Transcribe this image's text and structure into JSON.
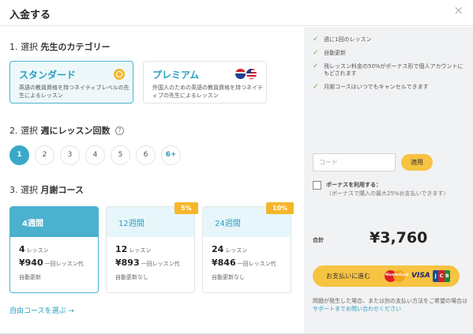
{
  "header": {
    "title": "入金する",
    "close": "×"
  },
  "step1": {
    "num": "1. 選択",
    "label": "先生のカテゴリー",
    "categories": [
      {
        "name": "スタンダード",
        "desc": "英語の教員資格を持つネイティブレベルの先生によるレッスン",
        "icon": "globe-icon"
      },
      {
        "name": "プレミアム",
        "desc": "外国人のための英語の教員資格を持つネイティブの先生によるレッスン",
        "icon": "flags-icon"
      }
    ]
  },
  "step2": {
    "num": "2. 選択",
    "label": "週にレッスン回数",
    "help": "?",
    "options": [
      "1",
      "2",
      "3",
      "4",
      "5",
      "6",
      "6+"
    ],
    "selected": "1"
  },
  "step3": {
    "num": "3. 選択",
    "label": "月謝コース",
    "courses": [
      {
        "weeks": "4週間",
        "lessons": "4",
        "lessons_unit": "レッスン",
        "price": "¥940",
        "price_unit": "一回レッスン代",
        "renew": "自動更新",
        "badge": ""
      },
      {
        "weeks": "12週間",
        "lessons": "12",
        "lessons_unit": "レッスン",
        "price": "¥893",
        "price_unit": "一回レッスン代",
        "renew": "自動更新なし",
        "badge": "5%"
      },
      {
        "weeks": "24週間",
        "lessons": "24",
        "lessons_unit": "レッスン",
        "price": "¥846",
        "price_unit": "一回レッスン代",
        "renew": "自動更新なし",
        "badge": "10%"
      }
    ],
    "free_link": "自由コースを選ぶ →"
  },
  "sidebar": {
    "features": [
      "週に1回のレッスン",
      "自動更新",
      "残レッスン料金の50%がボーナス形で個人アカウントにもどされます",
      "月謝コースはいつでもキャンセルできます"
    ],
    "code_placeholder": "コード",
    "apply": "適用",
    "bonus_label": "ボーナスを利用する：",
    "bonus_desc": "（ボーナスで購入の最大25%お支払いできます）",
    "total_label": "合計",
    "total_value": "¥3,760",
    "pay_label": "お支払いに進む",
    "visa": "VISA",
    "mastercard": "MasterCard",
    "jcb": [
      "J",
      "C",
      "B"
    ],
    "support_text": "問題が発生した場合、または別の支払い方法をご希望の場合は",
    "support_link": "サポートまでお問い合わせください"
  },
  "colors": {
    "accent": "#3aa9c9",
    "yellow": "#f6c342",
    "badge": "#f6b62c",
    "check": "#5db34a"
  }
}
